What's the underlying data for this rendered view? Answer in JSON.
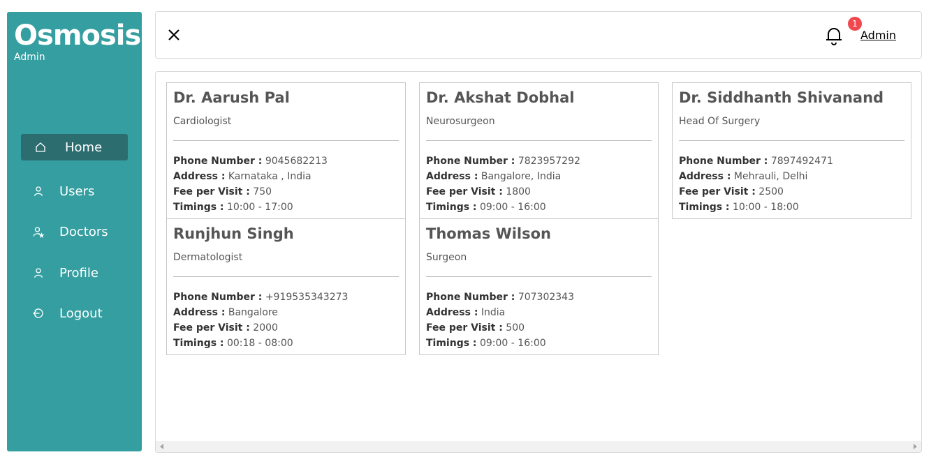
{
  "sidebar": {
    "brand": "Osmosis",
    "subtitle": "Admin",
    "items": [
      {
        "label": "Home",
        "icon": "home-icon",
        "active": true
      },
      {
        "label": "Users",
        "icon": "user-icon"
      },
      {
        "label": "Doctors",
        "icon": "doctor-icon"
      },
      {
        "label": "Profile",
        "icon": "profile-icon"
      },
      {
        "label": "Logout",
        "icon": "logout-icon"
      }
    ]
  },
  "header": {
    "notification_count": "1",
    "user_link": "Admin"
  },
  "labels": {
    "phone": "Phone Number :",
    "address": "Address :",
    "fee": "Fee per Visit :",
    "timings": "Timings :"
  },
  "doctors": [
    {
      "name": "Dr. Aarush Pal",
      "specialization": "Cardiologist",
      "phone": "9045682213",
      "address": "Karnataka , India",
      "fee": "750",
      "timings": "10:00 - 17:00"
    },
    {
      "name": "Dr. Akshat Dobhal",
      "specialization": "Neurosurgeon",
      "phone": "7823957292",
      "address": "Bangalore, India",
      "fee": "1800",
      "timings": "09:00 - 16:00"
    },
    {
      "name": "Dr. Siddhanth Shivanand",
      "specialization": "Head Of Surgery",
      "phone": "7897492471",
      "address": "Mehrauli, Delhi",
      "fee": "2500",
      "timings": "10:00 - 18:00"
    },
    {
      "name": "Runjhun Singh",
      "specialization": "Dermatologist",
      "phone": "+919535343273",
      "address": "Bangalore",
      "fee": "2000",
      "timings": "00:18 - 08:00"
    },
    {
      "name": "Thomas Wilson",
      "specialization": "Surgeon",
      "phone": "707302343",
      "address": "India",
      "fee": "500",
      "timings": "09:00 - 16:00"
    }
  ],
  "colors": {
    "sidebar": "#349ea0",
    "active": "#2c6e70",
    "badge": "#f0484f"
  }
}
